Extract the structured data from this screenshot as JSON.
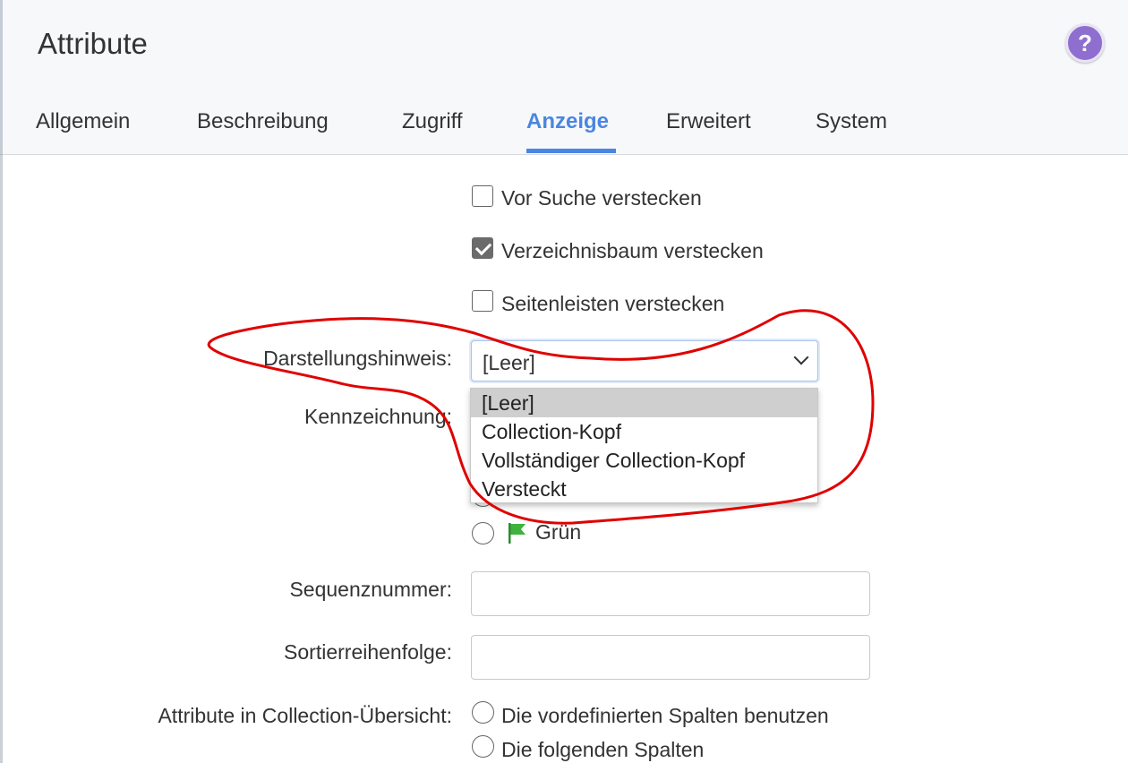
{
  "dialog": {
    "title": "Attribute",
    "help_icon": "question-circle-icon",
    "help_label": "?"
  },
  "tabs": [
    {
      "label": "Allgemein",
      "active": false
    },
    {
      "label": "Beschreibung",
      "active": false
    },
    {
      "label": "Zugriff",
      "active": false
    },
    {
      "label": "Anzeige",
      "active": true
    },
    {
      "label": "Erweitert",
      "active": false
    },
    {
      "label": "System",
      "active": false
    }
  ],
  "checkboxes": [
    {
      "label": "Vor Suche verstecken",
      "checked": false
    },
    {
      "label": "Verzeichnisbaum verstecken",
      "checked": true
    },
    {
      "label": "Seitenleisten verstecken",
      "checked": false
    }
  ],
  "display_hint": {
    "label": "Darstellungshinweis:",
    "value": "[Leer]",
    "options": [
      "[Leer]",
      "Collection-Kopf",
      "Vollständiger Collection-Kopf",
      "Versteckt"
    ],
    "selected_index": 0
  },
  "marking": {
    "label": "Kennzeichnung:",
    "visible_option": {
      "label": "Grün",
      "icon": "green-flag-icon",
      "color": "#3db33d"
    }
  },
  "sequence": {
    "label": "Sequenznummer:",
    "value": ""
  },
  "sort_order": {
    "label": "Sortierreihenfolge:",
    "value": ""
  },
  "collection_overview": {
    "label": "Attribute in Collection-Übersicht:",
    "options": [
      "Die vordefinierten Spalten benutzen",
      "Die folgenden Spalten"
    ]
  },
  "colors": {
    "accent": "#4a86e0",
    "annotation": "#e00000"
  }
}
